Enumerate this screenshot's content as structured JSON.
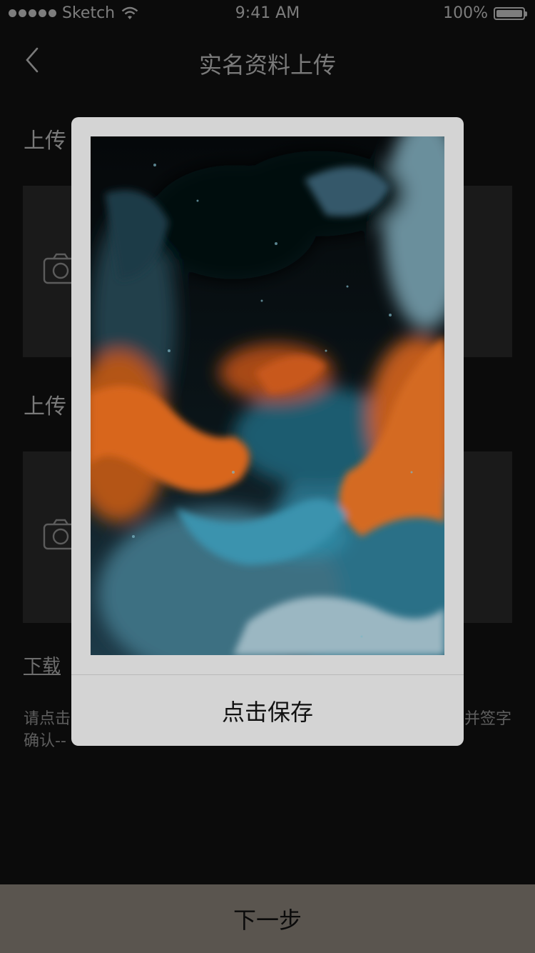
{
  "status_bar": {
    "carrier": "Sketch",
    "time": "9:41 AM",
    "battery": "100%"
  },
  "nav": {
    "title": "实名资料上传"
  },
  "sections": [
    {
      "title": "上传"
    },
    {
      "title": "上传"
    }
  ],
  "download_link": "下载",
  "hint": {
    "line1_start": "请点击",
    "line1_end": "并签字",
    "line2": "确认--"
  },
  "modal": {
    "save_label": "点击保存"
  },
  "footer": {
    "next_label": "下一步"
  },
  "colors": {
    "accent_orange": "#d8661b",
    "accent_teal": "#2f7f97"
  }
}
